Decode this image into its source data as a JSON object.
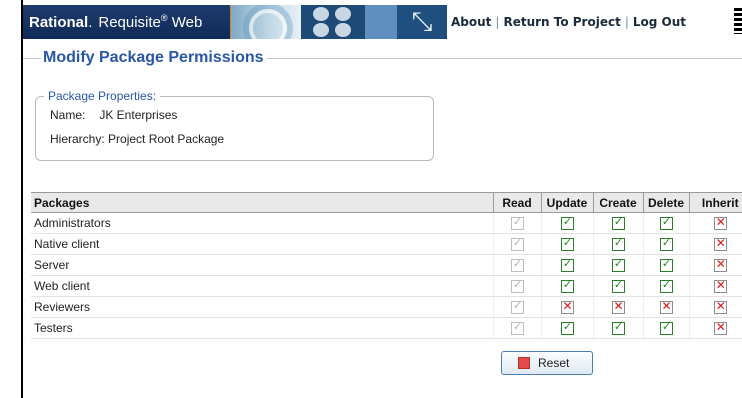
{
  "header": {
    "brand_rational": "Rational",
    "brand_dot": ".",
    "brand_product": "Requisite",
    "brand_reg": "®",
    "brand_web": " Web",
    "nav": [
      {
        "label": "About"
      },
      {
        "label": "Return To Project"
      },
      {
        "label": "Log Out"
      }
    ],
    "nav_separator": "|"
  },
  "page": {
    "title": "Modify Package Permissions"
  },
  "package_properties": {
    "legend": "Package Properties:",
    "name_label": "Name:",
    "name_value": "JK Enterprises",
    "hierarchy_label": "Hierarchy:",
    "hierarchy_value": "Project Root Package"
  },
  "permissions_table": {
    "columns": [
      "Packages",
      "Read",
      "Update",
      "Create",
      "Delete",
      "Inherit"
    ],
    "rows": [
      {
        "package": "Administrators",
        "read": true,
        "update": true,
        "create": true,
        "delete": true,
        "inherit": false
      },
      {
        "package": "Native client",
        "read": true,
        "update": true,
        "create": true,
        "delete": true,
        "inherit": false
      },
      {
        "package": "Server",
        "read": true,
        "update": true,
        "create": true,
        "delete": true,
        "inherit": false
      },
      {
        "package": "Web client",
        "read": true,
        "update": true,
        "create": true,
        "delete": true,
        "inherit": false
      },
      {
        "package": "Reviewers",
        "read": true,
        "update": false,
        "create": false,
        "delete": false,
        "inherit": false
      },
      {
        "package": "Testers",
        "read": true,
        "update": true,
        "create": true,
        "delete": true,
        "inherit": false
      }
    ]
  },
  "actions": {
    "reset_label": "Reset"
  },
  "colors": {
    "accent": "#2a56a6",
    "check_green": "#1e8a1e",
    "cross_red": "#e01919",
    "brand_bg": "#1e3b6e"
  },
  "icons": {
    "checked": "check-icon",
    "unchecked": "cross-icon",
    "reset": "reset-icon"
  }
}
